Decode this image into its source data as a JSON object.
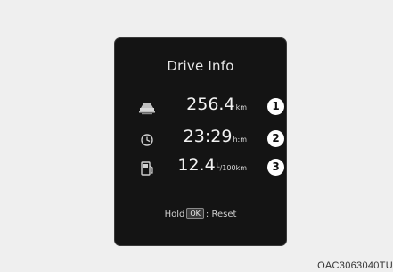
{
  "display": {
    "title": "Drive Info",
    "rows": [
      {
        "icon": "road-distance-icon",
        "value": "256.4",
        "unit": "km",
        "badge": "1"
      },
      {
        "icon": "clock-icon",
        "value": "23:29",
        "unit": "h:m",
        "badge": "2"
      },
      {
        "icon": "fuel-pump-icon",
        "value": "12.4",
        "unit_numerator": "L",
        "unit_denominator": "100km",
        "badge": "3"
      }
    ],
    "footer": {
      "hold_label": "Hold",
      "button_label": "OK",
      "action_label": ": Reset"
    }
  },
  "figure_code": "OAC3063040TU",
  "colors": {
    "background": "#efefef",
    "panel": "#141414",
    "text": "#f2f2f2"
  }
}
